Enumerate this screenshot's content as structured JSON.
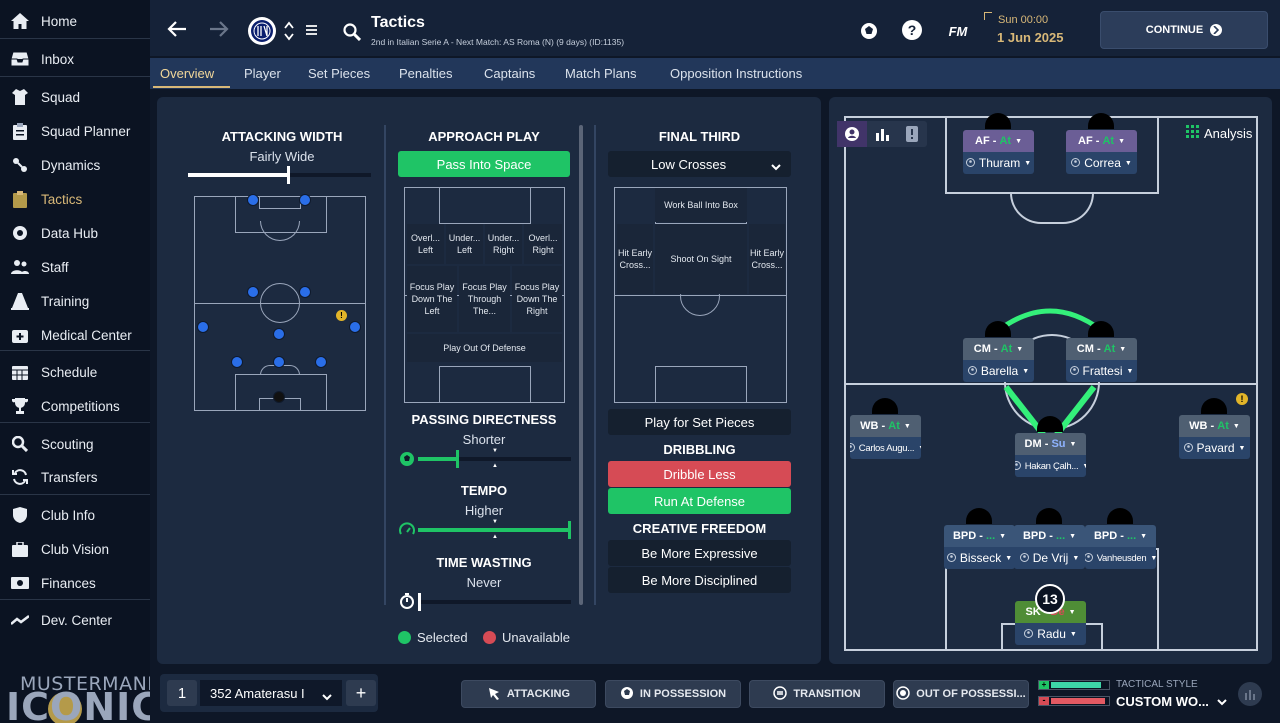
{
  "sidebar": {
    "items": [
      {
        "label": "Home",
        "icon": "home-icon"
      },
      {
        "label": "Inbox",
        "icon": "inbox-icon"
      },
      {
        "label": "Squad",
        "icon": "shirt-icon"
      },
      {
        "label": "Squad Planner",
        "icon": "clipboard-icon"
      },
      {
        "label": "Dynamics",
        "icon": "dynamics-icon"
      },
      {
        "label": "Tactics",
        "icon": "tactics-icon"
      },
      {
        "label": "Data Hub",
        "icon": "data-hub-icon"
      },
      {
        "label": "Staff",
        "icon": "staff-icon"
      },
      {
        "label": "Training",
        "icon": "training-cone-icon"
      },
      {
        "label": "Medical Center",
        "icon": "medical-icon"
      },
      {
        "label": "Schedule",
        "icon": "calendar-icon"
      },
      {
        "label": "Competitions",
        "icon": "trophy-icon"
      },
      {
        "label": "Scouting",
        "icon": "magnifier-icon"
      },
      {
        "label": "Transfers",
        "icon": "transfer-icon"
      },
      {
        "label": "Club Info",
        "icon": "shield-icon"
      },
      {
        "label": "Club Vision",
        "icon": "briefcase-icon"
      },
      {
        "label": "Finances",
        "icon": "money-icon"
      },
      {
        "label": "Dev. Center",
        "icon": "trend-icon"
      }
    ],
    "active": "Tactics",
    "brand_top": "MUSTERMANN",
    "brand_bottom": "ICONIC"
  },
  "topbar": {
    "title": "Tactics",
    "subtitle": "2nd in Italian Serie A - Next Match: AS Roma (N) (9 days) (ID:1135)",
    "day": "Sun 00:00",
    "date": "1 Jun 2025",
    "fm_label": "FM",
    "continue_label": "CONTINUE"
  },
  "tabs": [
    "Overview",
    "Player",
    "Set Pieces",
    "Penalties",
    "Captains",
    "Match Plans",
    "Opposition Instructions"
  ],
  "active_tab": "Overview",
  "attacking_width": {
    "title": "ATTACKING WIDTH",
    "value": "Fairly Wide",
    "level": 0.55
  },
  "approach_play": {
    "title": "APPROACH PLAY",
    "selected": "Pass Into Space",
    "zones": {
      "overlap_left": "Overl... Left",
      "underlap_left": "Under... Left",
      "underlap_right": "Under... Right",
      "overlap_right": "Overl... Right",
      "focus_left": "Focus Play Down The Left",
      "focus_middle": "Focus Play Through The...",
      "focus_right": "Focus Play Down The Right",
      "play_out": "Play Out Of Defense"
    }
  },
  "passing_directness": {
    "title": "PASSING DIRECTNESS",
    "value": "Shorter",
    "level": 0.25
  },
  "tempo": {
    "title": "TEMPO",
    "value": "Higher",
    "level": 1.0
  },
  "time_wasting": {
    "title": "TIME WASTING",
    "value": "Never",
    "level": 0.0
  },
  "final_third": {
    "title": "FINAL THIRD",
    "dropdown": "Low Crosses",
    "zones": {
      "work_ball": "Work Ball Into Box",
      "hit_left": "Hit Early Cross...",
      "shoot": "Shoot On Sight",
      "hit_right": "Hit Early Cross..."
    },
    "set_pieces": "Play for Set Pieces"
  },
  "dribbling": {
    "title": "DRIBBLING",
    "less": "Dribble Less",
    "run": "Run At Defense"
  },
  "creative_freedom": {
    "title": "CREATIVE FREEDOM",
    "expressive": "Be More Expressive",
    "disciplined": "Be More Disciplined"
  },
  "legend": {
    "selected": "Selected",
    "unavailable": "Unavailable"
  },
  "colors": {
    "selected": "#1fc466",
    "unavailable": "#d64b55",
    "accent": "#d8b878",
    "attack": "#6b5e96",
    "midfield": "#4f5f72",
    "defense": "#3a5578",
    "keeper": "#4f8d36"
  },
  "pitch": {
    "analysis_label": "Analysis",
    "players": [
      {
        "pos": "AF",
        "role": "At",
        "name": "Thuram"
      },
      {
        "pos": "AF",
        "role": "At",
        "name": "Correa"
      },
      {
        "pos": "CM",
        "role": "At",
        "name": "Barella"
      },
      {
        "pos": "CM",
        "role": "At",
        "name": "Frattesi"
      },
      {
        "pos": "WB",
        "role": "At",
        "name": "Carlos Augu..."
      },
      {
        "pos": "DM",
        "role": "Su",
        "name": "Hakan Çalh..."
      },
      {
        "pos": "WB",
        "role": "At",
        "name": "Pavard"
      },
      {
        "pos": "BPD",
        "role": "...",
        "name": "Bisseck"
      },
      {
        "pos": "BPD",
        "role": "...",
        "name": "De Vrij"
      },
      {
        "pos": "BPD",
        "role": "...",
        "name": "Vanheusden"
      },
      {
        "pos": "SK",
        "role": "De",
        "name": "Radu"
      }
    ],
    "gk_number": "13"
  },
  "bottom": {
    "slot": "1",
    "tactic_name": "352 Amaterasu I",
    "add_label": "+",
    "attacking": "ATTACKING",
    "in_possession": "IN POSSESSION",
    "transition": "TRANSITION",
    "out_of_possession": "OUT OF POSSESSI...",
    "style_label": "TACTICAL STYLE",
    "style_value": "CUSTOM WO...",
    "style_plus": "+",
    "style_minus": "-"
  }
}
